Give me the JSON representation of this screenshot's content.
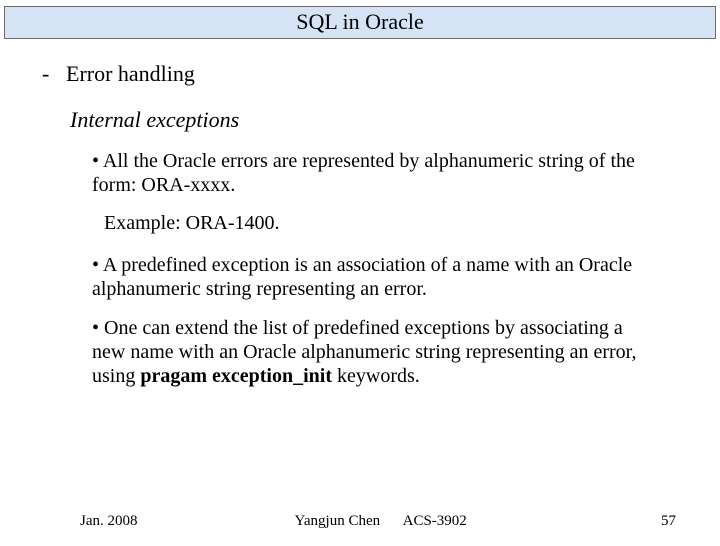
{
  "title": "SQL in Oracle",
  "section": {
    "dash": "-",
    "heading": "Error handling"
  },
  "sub": "Internal exceptions",
  "bullets": {
    "b1": "• All the Oracle errors are represented by alphanumeric string of the form: ORA-xxxx.",
    "example": "Example: ORA-1400.",
    "b2": "• A predefined exception is an association of a name with an Oracle alphanumeric string representing an error.",
    "b3_pre": "• One can extend the list of predefined exceptions by associating a new name with an Oracle alphanumeric string representing an error, using ",
    "b3_bold": "pragam exception_init",
    "b3_post": " keywords."
  },
  "footer": {
    "date": "Jan. 2008",
    "author": "Yangjun Chen",
    "course": "ACS-3902",
    "page": "57"
  }
}
